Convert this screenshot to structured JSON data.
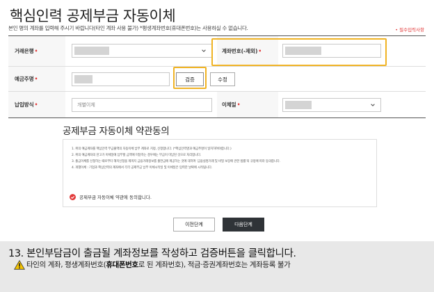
{
  "page": {
    "title": "핵심인력 공제부금 자동이체",
    "subtitle": "본인 명의 계좌를 입력해 주시기 바랍니다(타인 계좌 사용 불가) *평생계좌번호(휴대폰번호)는 사용하실 수 없습니다.",
    "required_note": "• 필수입력사항"
  },
  "form": {
    "bank_label": "거래은행",
    "account_label": "계좌번호(-제외)",
    "holder_label": "예금주명",
    "verify_button": "검증",
    "edit_button": "수정",
    "payment_method_label": "납입방식",
    "payment_method_value": "개별이체",
    "transfer_day_label": "이체일",
    "required_mark": "•"
  },
  "terms": {
    "title": "공제부금 자동이체 약관동의",
    "lines": [
      "1. 위의 예금계좌를 핵심인력 부금출액의 자동이체 납부 계좌로 지정, 신청합니다. (*핵심인력명과 예금주명이 일치하여야합니다.)",
      "2. 위의 예금계좌의 잔고가 이체일에 납부할 금액에 미달하는 경우에는 부금이 미납된 것으로 처리합니다.",
      "3. 출금이체를 신청하는 때로부터 해지신청을 제까지 금융거래정보를 출연금에 제공하는 것에 대하여 '금융실명거래 및 비밀 보장에 관한 법률'의 규정에 따라 동의합니다.",
      "4. 개별이체 : 기업과 핵심인력의 계좌에서 각각 공제부금 납부 이체시작일 및 이체일은 입력한 날짜에 시작됩니다."
    ],
    "agree_label": "공제부금 자동이체 약관에 동의합니다."
  },
  "nav": {
    "prev_button": "이전단계",
    "next_button": "다음단계"
  },
  "caption": {
    "main": "13.  본인부담금이 출금될 계좌정보를 작성하고 검증버튼을 클릭합니다.",
    "warn_prefix": "타인의 계좌, 평생계좌번호(",
    "warn_bold": "휴대폰번호",
    "warn_suffix": "로 된 계좌번호), 적금·증권계좌번호는 계좌등록 불가"
  },
  "colors": {
    "highlight": "#f0b323",
    "required": "#e23b3b",
    "next_button_bg": "#2f3337",
    "caption_bg": "#e8e8e8"
  },
  "icons": {
    "select_arrow": "chevron-down-icon",
    "agree_check": "check-circle-icon",
    "warning": "warning-icon"
  }
}
